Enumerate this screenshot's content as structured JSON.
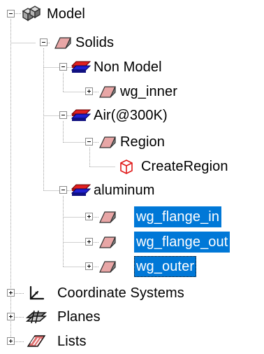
{
  "tree": {
    "root": {
      "label": "Model",
      "icon": "model-icon",
      "children": {
        "solids": {
          "label": "Solids",
          "icon": "solid-block-icon",
          "groups": [
            {
              "label": "Non Model",
              "icon": "material-stack-icon",
              "items": [
                {
                  "label": "wg_inner",
                  "icon": "solid-block-icon",
                  "selected": false
                }
              ]
            },
            {
              "label": "Air(@300K)",
              "icon": "material-stack-icon",
              "region": {
                "label": "Region",
                "icon": "solid-block-icon",
                "operation": {
                  "label": "CreateRegion",
                  "icon": "create-region-icon"
                }
              }
            },
            {
              "label": "aluminum",
              "icon": "material-stack-icon",
              "items": [
                {
                  "label": "wg_flange_in",
                  "icon": "solid-block-icon",
                  "selected": true
                },
                {
                  "label": "wg_flange_out",
                  "icon": "solid-block-icon",
                  "selected": true
                },
                {
                  "label": "wg_outer",
                  "icon": "solid-block-icon",
                  "selected": true,
                  "focused": true
                }
              ]
            }
          ]
        },
        "coordinate_systems": {
          "label": "Coordinate Systems",
          "icon": "coordinate-axes-icon"
        },
        "planes": {
          "label": "Planes",
          "icon": "planes-icon"
        },
        "lists": {
          "label": "Lists",
          "icon": "lists-icon"
        }
      }
    },
    "colors": {
      "selection": "#0078d7",
      "solid_face": "#e8a6a6",
      "solid_side": "#8a8a8a",
      "material_red": "#e02020",
      "material_blue": "#2020d0"
    }
  }
}
